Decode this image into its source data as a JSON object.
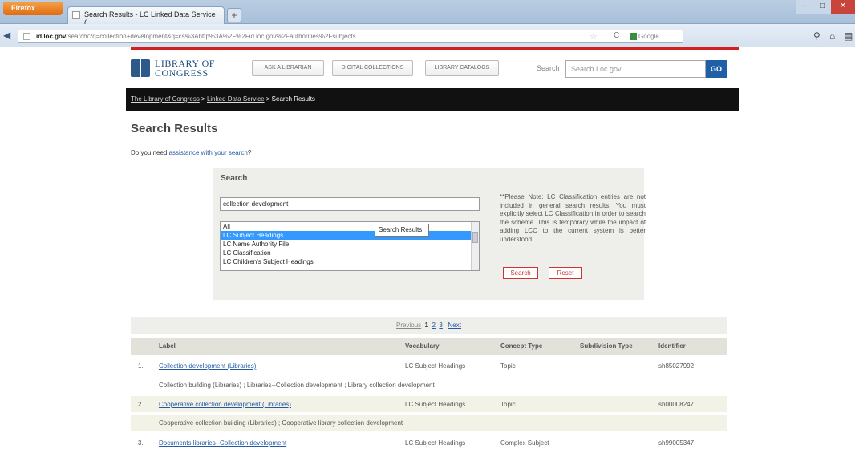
{
  "browser": {
    "menu_button": "Firefox",
    "tab_title": "Search Results - LC Linked Data Service (...",
    "new_tab": "+",
    "url_host": "id.loc.gov",
    "url_rest": "/search/?q=collection+development&q=cs%3Ahttp%3A%2F%2Fid.loc.gov%2Fauthorities%2Fsubjects",
    "search_engine": "Google"
  },
  "header": {
    "logo_line1": "LIBRARY OF",
    "logo_line2": "CONGRESS",
    "nav": [
      "ASK A LIBRARIAN",
      "DIGITAL COLLECTIONS",
      "LIBRARY CATALOGS"
    ],
    "search_label": "Search",
    "search_placeholder": "Search Loc.gov",
    "go_label": "GO"
  },
  "breadcrumb": {
    "items": [
      "The Library of Congress",
      "Linked Data Service"
    ],
    "separator": " > ",
    "current": "Search Results"
  },
  "page": {
    "title": "Search Results",
    "assist_prefix": "Do you need ",
    "assist_link": "assistance with your search",
    "assist_suffix": "?"
  },
  "search_box": {
    "title": "Search",
    "query": "collection development",
    "options": [
      "All",
      "LC Subject Headings",
      "LC Name Authority File",
      "LC Classification",
      "LC Children's Subject Headings"
    ],
    "selected": "LC Subject Headings",
    "tooltip": "Search Results",
    "note": "**Please Note: LC Classification entries are not included in general search results. You must explicitly select LC Classification in order to search the scheme. This is temporary while the impact of adding LCC to the current system is better understood.",
    "search_btn": "Search",
    "reset_btn": "Reset"
  },
  "pager": {
    "previous": "Previous",
    "pages": [
      "1",
      "2",
      "3"
    ],
    "current_page": "1",
    "next": "Next"
  },
  "table": {
    "headers": [
      "Label",
      "Vocabulary",
      "Concept Type",
      "Subdivision Type",
      "Identifier"
    ],
    "rows": [
      {
        "num": "1.",
        "label": "Collection development (Libraries)",
        "vocab": "LC Subject Headings",
        "ctype": "Topic",
        "subtype": "",
        "id": "sh85027992",
        "variants": "Collection building (Libraries) ; Libraries--Collection development ; Library collection development"
      },
      {
        "num": "2.",
        "label": "Cooperative collection development (Libraries)",
        "vocab": "LC Subject Headings",
        "ctype": "Topic",
        "subtype": "",
        "id": "sh00008247",
        "variants": "Cooperative collection building (Libraries) ; Cooperative library collection development"
      },
      {
        "num": "3.",
        "label": "Documents libraries--Collection development",
        "vocab": "LC Subject Headings",
        "ctype": "Complex Subject",
        "subtype": "",
        "id": "sh99005347",
        "variants": ""
      }
    ]
  }
}
